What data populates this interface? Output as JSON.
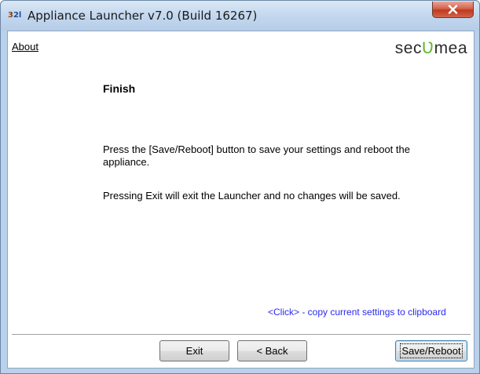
{
  "window": {
    "title": "Appliance Launcher v7.0 (Build 16267)",
    "icon_text": "3",
    "icon_sub": "2l",
    "close_glyph": "x"
  },
  "menu": {
    "about_label": "About"
  },
  "brand": {
    "logo_prefix": "sec",
    "logo_mark": "Ʋ",
    "logo_suffix": "mea",
    "logo_mark_color": "#5fb52a"
  },
  "page": {
    "heading": "Finish",
    "instruction": "Press the [Save/Reboot] button to save your settings and reboot the appliance.",
    "exit_note": "Pressing Exit will exit the Launcher and no changes will be saved.",
    "copy_link": "<Click> - copy current settings to clipboard"
  },
  "buttons": {
    "exit_label": "Exit",
    "back_label": "< Back",
    "save_label": "Save/Reboot"
  },
  "colors": {
    "link_blue": "#2a2af0",
    "close_red": "#c0391d",
    "frame": "#b9d1ea"
  }
}
